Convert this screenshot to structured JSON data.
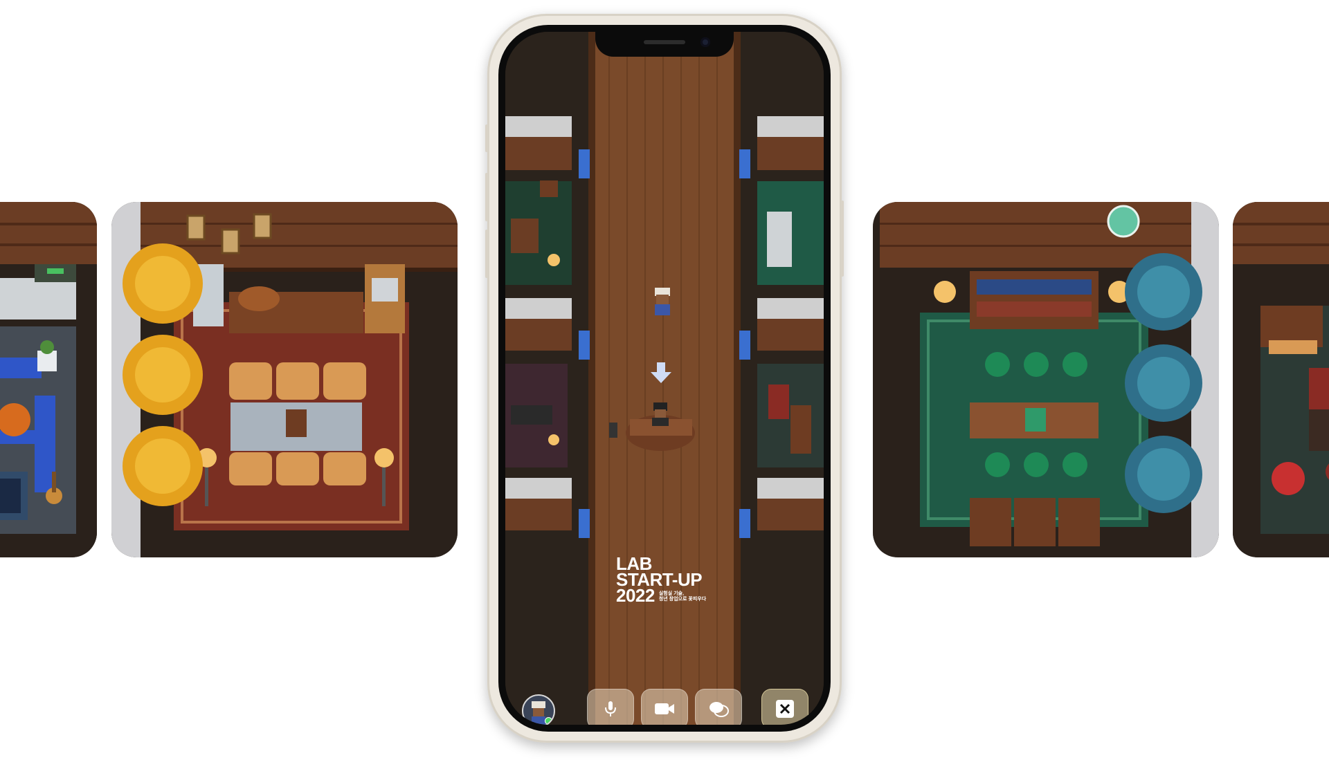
{
  "screen": {
    "logo": {
      "line1": "LAB",
      "line2": "START-UP",
      "line3": "2022",
      "tagline_line1": "실험실 기술,",
      "tagline_line2": "청년 창업으로 꽃피우다"
    },
    "toolbar": {
      "icons": [
        "avatar",
        "microphone-icon",
        "video-camera-icon",
        "chat-bubbles-icon",
        "close-icon"
      ],
      "avatar_status": "online"
    },
    "hint_arrow": "down-arrow-icon"
  },
  "rooms": [
    {
      "id": "far-left",
      "theme": "living room"
    },
    {
      "id": "left",
      "theme": "kitchen lounge"
    },
    {
      "id": "right",
      "theme": "library"
    },
    {
      "id": "far-right",
      "theme": "red lounge"
    }
  ],
  "colors": {
    "wood_wall": "#6b3d24",
    "wood_floor": "#7a4a2a",
    "autumn_tree": "#e4a11d",
    "green_carpet": "#1f5a46",
    "red_carpet": "#7a2f22",
    "blue_tree": "#2f6f8a"
  }
}
